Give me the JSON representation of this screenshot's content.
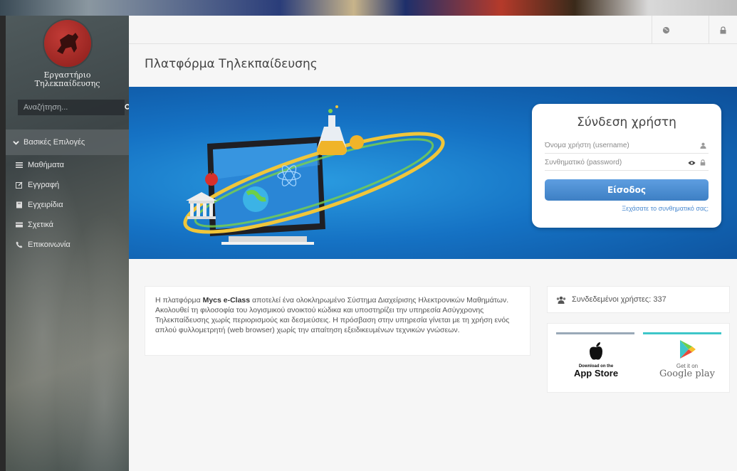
{
  "sidebar": {
    "logo_text_line1": "Εργαστήριο",
    "logo_text_line2": "Τηλεκπαίδευσης",
    "search_placeholder": "Αναζήτηση...",
    "group_header": "Βασικές Επιλογές",
    "items": [
      {
        "label": "Μαθήματα",
        "icon": "list-icon"
      },
      {
        "label": "Εγγραφή",
        "icon": "edit-icon"
      },
      {
        "label": "Εγχειρίδια",
        "icon": "book-icon"
      },
      {
        "label": "Σχετικά",
        "icon": "card-icon"
      },
      {
        "label": "Επικοινωνία",
        "icon": "phone-icon"
      }
    ]
  },
  "topbar": {
    "icons": [
      "globe-icon",
      "lock-icon"
    ]
  },
  "main": {
    "page_title": "Πλατφόρμα Τηλεκπαίδευσης"
  },
  "login": {
    "title": "Σύνδεση χρήστη",
    "username_placeholder": "Όνομα χρήστη (username)",
    "password_placeholder": "Συνθηματικό (password)",
    "button_label": "Είσοδος",
    "forgot_link": "Ξεχάσατε το συνθηματικό σας;"
  },
  "description": {
    "prefix": "Η πλατφόρμα ",
    "brand": "Mycs e-Class",
    "text": " αποτελεί ένα ολοκληρωμένο Σύστημα Διαχείρισης Ηλεκτρονικών Μαθημάτων. Ακολουθεί τη φιλοσοφία του λογισμικού ανοικτού κώδικα και υποστηρίζει την υπηρεσία Ασύγχρονης Τηλεκπαίδευσης χωρίς περιορισμούς και δεσμεύσεις. Η πρόσβαση στην υπηρεσία γίνεται με τη χρήση ενός απλού φυλλομετρητή (web browser) χωρίς την απαίτηση εξειδικευμένων τεχνικών γνώσεων."
  },
  "online_users": {
    "label": "Συνδεδεμένοι χρήστες: 337"
  },
  "apps": {
    "appstore_small": "Download on the",
    "appstore_big": "App Store",
    "google_small": "Get it on",
    "google_big": "Google play"
  },
  "colors": {
    "banner_blue": "#1572c4",
    "button_blue": "#4a8ad0",
    "logo_red": "#a82a26",
    "teal_accent": "#3ec6c9"
  }
}
